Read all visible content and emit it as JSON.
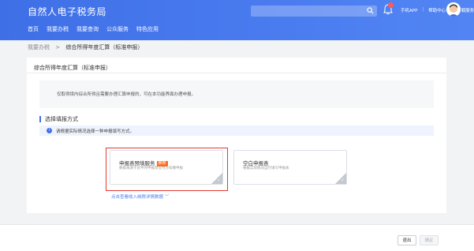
{
  "header": {
    "brand": "自然人电子税务局",
    "nav": [
      "首页",
      "我要办税",
      "我要查询",
      "公众服务",
      "特色应用"
    ],
    "links": [
      "手机APP",
      "帮助中心",
      "下载服务"
    ]
  },
  "breadcrumb": {
    "parent": "我要办税",
    "separator": ">",
    "current": "综合所得年度汇算（标准申报）"
  },
  "panel": {
    "title": "综合所得年度汇算（标准申报）",
    "info": "仅取得境内综合所得且需要办理汇算申报的，可在本功能界面办理申报。",
    "section_title": "选择填报方式",
    "tip_icon": "i",
    "tip": "请根据实际情况选择一种申报填写方式。"
  },
  "cards": [
    {
      "title": "申报表预填服务",
      "badge": "推荐",
      "desc": "数据来源于您平时申报及支付方扣缴申报"
    },
    {
      "title": "空白申报表",
      "badge": "",
      "desc": "根据实际情况自行填写申报表"
    }
  ],
  "more_link": "点击查看收入纳税详情数据",
  "footer": {
    "exit": "退出",
    "confirm": "确定"
  },
  "colors": {
    "primary": "#3f6fe6",
    "highlight": "#e53935",
    "badge": "#ff6a1a"
  },
  "icons": [
    "search-icon",
    "bell-icon",
    "avatar-icon",
    "info-icon",
    "chevron-down-icon",
    "corner-check-icon"
  ]
}
